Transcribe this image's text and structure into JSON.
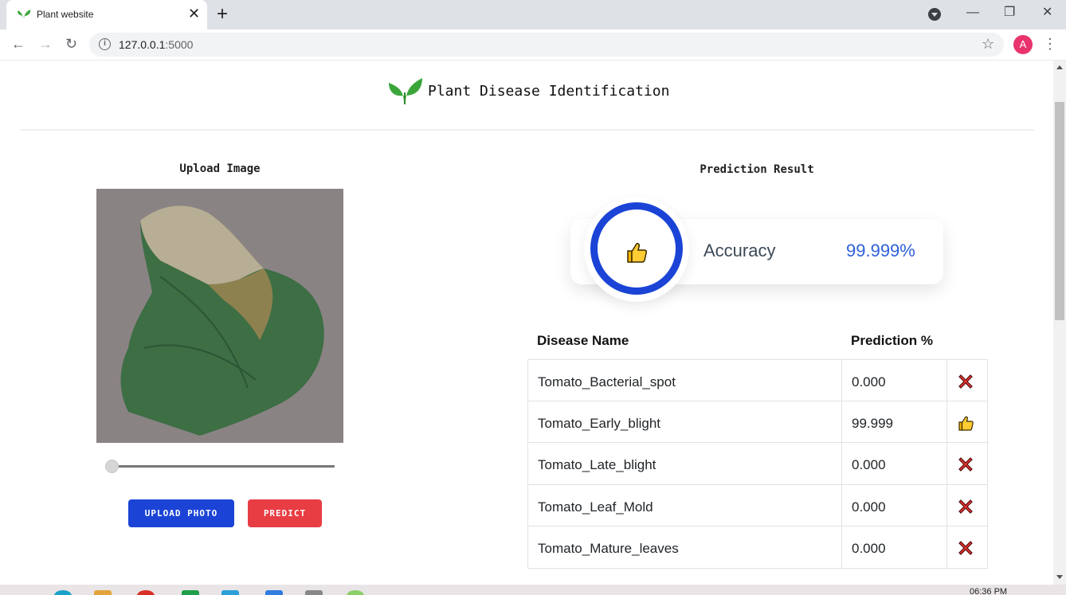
{
  "browser": {
    "tab_title": "Plant website",
    "url_host": "127.0.0.1",
    "url_port": ":5000",
    "profile_initial": "A"
  },
  "header": {
    "title": "Plant Disease Identification"
  },
  "upload": {
    "heading": "Upload Image",
    "slider_value": 0,
    "upload_button": "UPLOAD PHOTO",
    "predict_button": "PREDICT"
  },
  "result": {
    "heading": "Prediction Result",
    "accuracy_label": "Accuracy",
    "accuracy_value": "99.999%"
  },
  "table": {
    "col_name": "Disease Name",
    "col_pct": "Prediction %",
    "rows": [
      {
        "name": "Tomato_Bacterial_spot",
        "pct": "0.000",
        "icon": "cross-icon"
      },
      {
        "name": "Tomato_Early_blight",
        "pct": "99.999",
        "icon": "thumbs-up-icon"
      },
      {
        "name": "Tomato_Late_blight",
        "pct": "0.000",
        "icon": "cross-icon"
      },
      {
        "name": "Tomato_Leaf_Mold",
        "pct": "0.000",
        "icon": "cross-icon"
      },
      {
        "name": "Tomato_Mature_leaves",
        "pct": "0.000",
        "icon": "cross-icon"
      }
    ]
  },
  "taskbar": {
    "time": "06:36 PM"
  },
  "colors": {
    "primary": "#1b44d6",
    "danger": "#e73d43",
    "accuracy_text": "#2f60d8",
    "leaf_green": "#3aa63a"
  }
}
